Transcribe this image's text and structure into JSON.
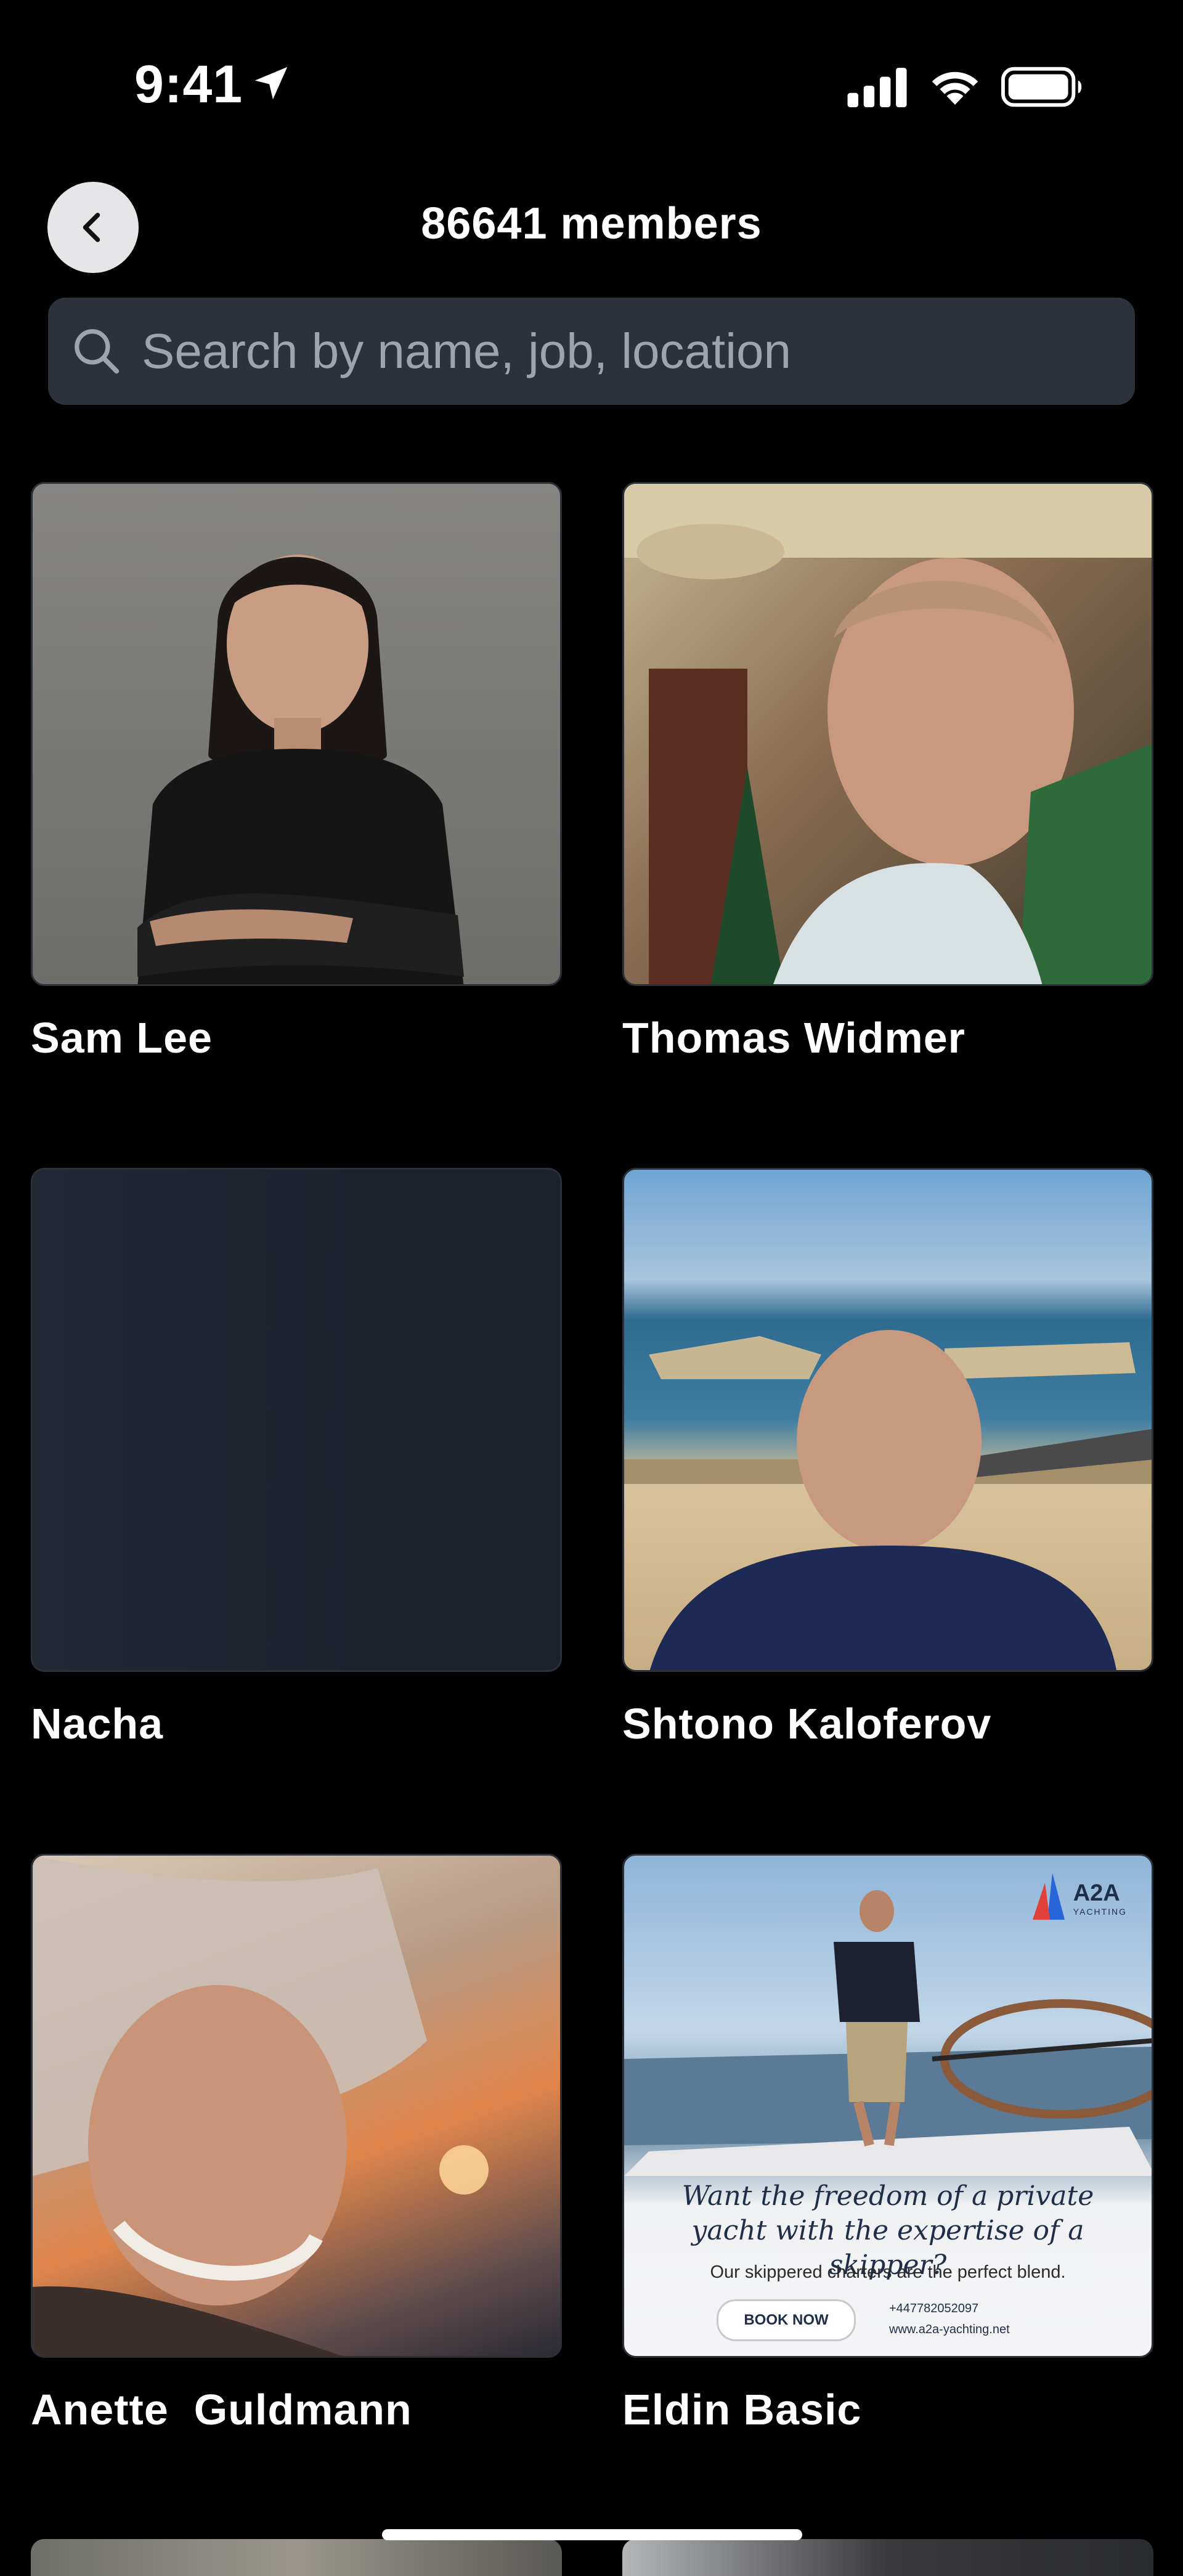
{
  "status_bar": {
    "time": "9:41",
    "icons": [
      "location-arrow-icon",
      "cellular-signal-icon",
      "wifi-icon",
      "battery-icon"
    ]
  },
  "header": {
    "back_icon": "chevron-left-icon",
    "title": "86641 members"
  },
  "search": {
    "icon": "search-icon",
    "placeholder": "Search by name, job, location",
    "value": ""
  },
  "members": [
    {
      "name": "Sam Lee"
    },
    {
      "name": "Thomas Widmer"
    },
    {
      "name": "Nacha"
    },
    {
      "name": "Shtono Kaloferov"
    },
    {
      "name": "Anette  Guldmann"
    },
    {
      "name": "Eldin Basic",
      "ad": {
        "logo": "A2A",
        "logo_sub": "YACHTING",
        "headline": "Want the freedom of a private yacht with the expertise of a skipper?",
        "body": "Our skippered charters are the perfect blend.",
        "cta": "BOOK NOW",
        "phone": "+447782052097",
        "website": "www.a2a-yachting.net"
      }
    }
  ],
  "colors": {
    "background": "#000000",
    "search_background": "#2c313b",
    "placeholder": "#9ea3ad",
    "back_button": "#e6e6e8",
    "empty_photo": "#1f2430"
  }
}
